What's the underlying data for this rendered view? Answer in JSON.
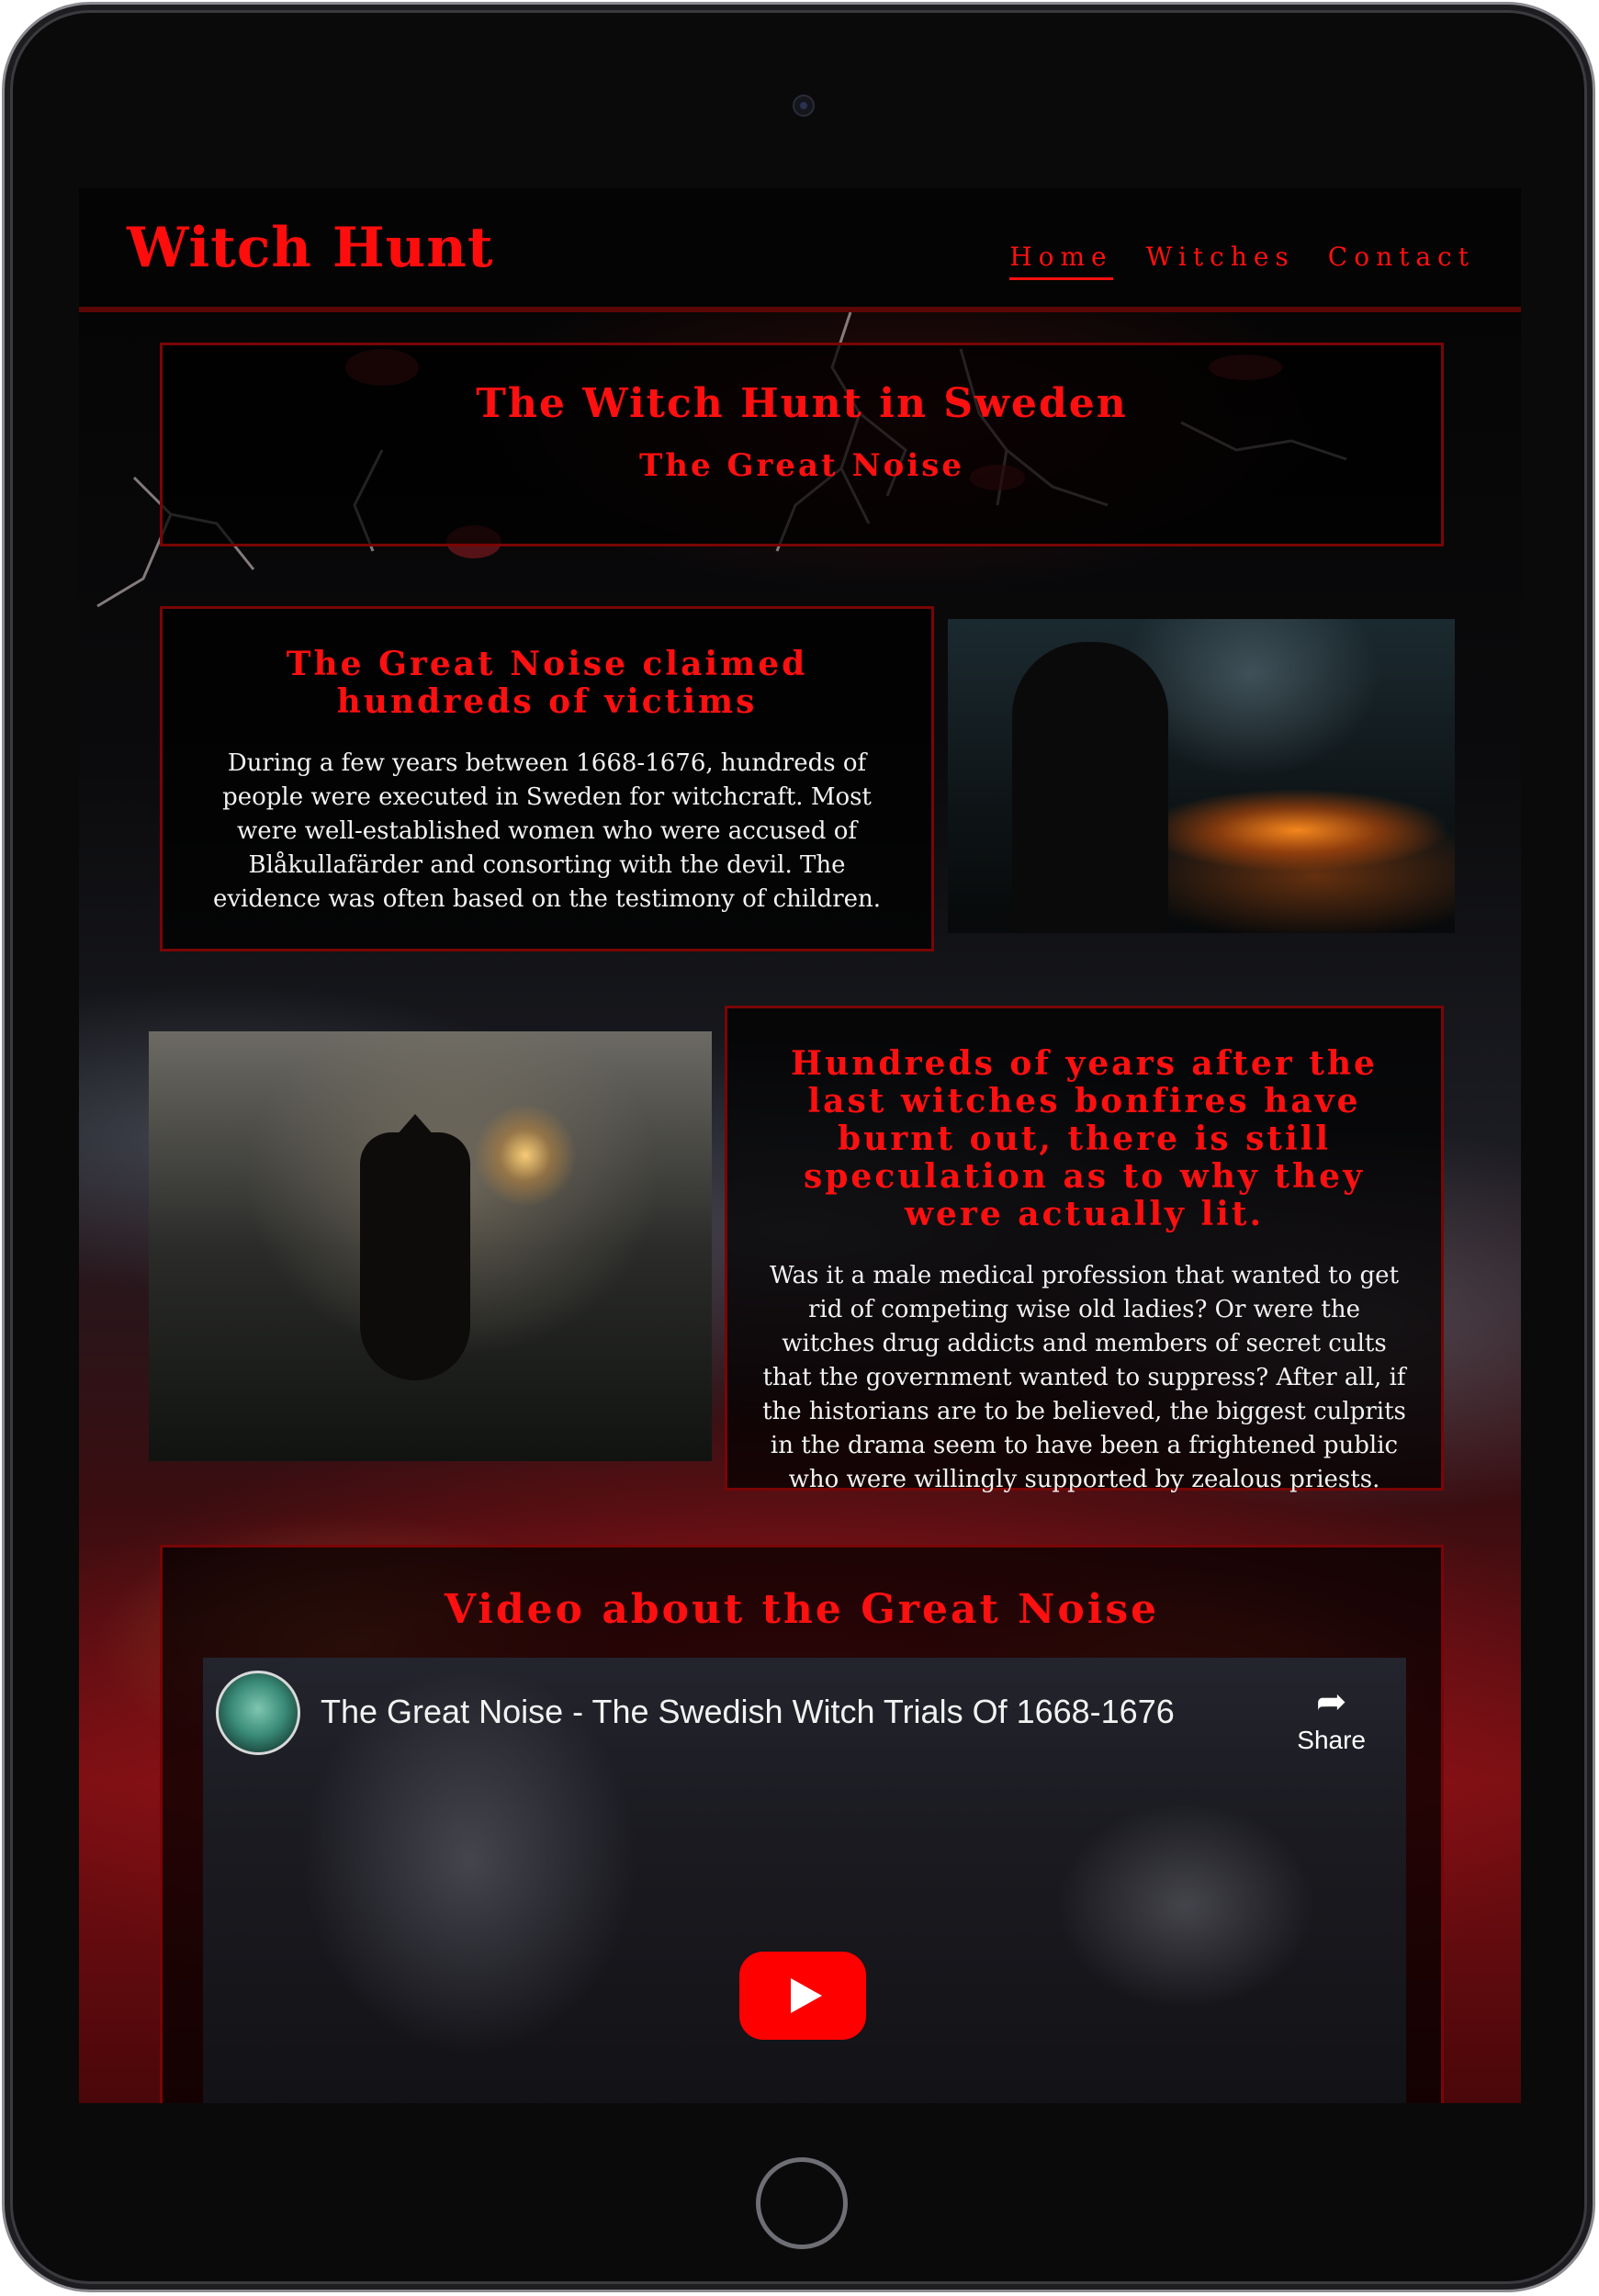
{
  "navbar": {
    "brand": "Witch Hunt",
    "links": [
      {
        "label": "Home",
        "active": true
      },
      {
        "label": "Witches",
        "active": false
      },
      {
        "label": "Contact",
        "active": false
      }
    ]
  },
  "hero": {
    "title": "The Witch Hunt in Sweden",
    "subtitle": "The Great Noise"
  },
  "section1": {
    "heading": "The Great Noise claimed hundreds of victims",
    "text": "During a few years between 1668-1676, hundreds of people were executed in Sweden for witchcraft. Most were well-established women who were accused of Blåkullafärder and consorting with the devil. The evidence was often based on the testimony of children."
  },
  "section2": {
    "heading": "Hundreds of years after the last witches bonfires have burnt out, there is still speculation as to why they were actually lit.",
    "text": "Was it a male medical profession that wanted to get rid of competing wise old ladies? Or were the witches drug addicts and members of secret cults that the government wanted to suppress? After all, if the historians are to be believed, the biggest culprits in the drama seem to have been a frightened public who were willingly supported by zealous priests."
  },
  "video_section": {
    "heading": "Video about the Great Noise",
    "video_title": "The Great Noise - The Swedish Witch Trials Of 1668-1676",
    "share_label": "Share"
  },
  "colors": {
    "accent": "#ff1010",
    "border": "#7a0505",
    "background": "#050505"
  },
  "icons": {
    "share": "share-arrow-icon",
    "play": "youtube-play-icon"
  }
}
